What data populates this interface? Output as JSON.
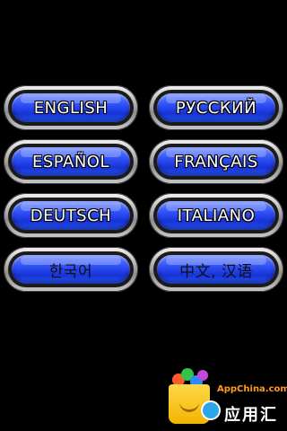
{
  "languages": [
    {
      "label": "ENGLISH"
    },
    {
      "label": "РУССКИЙ"
    },
    {
      "label": "ESPAÑOL"
    },
    {
      "label": "FRANÇAIS"
    },
    {
      "label": "DEUTSCH"
    },
    {
      "label": "ITALIANO"
    },
    {
      "label": "한국어"
    },
    {
      "label": "中文, 汉语"
    }
  ],
  "watermark": {
    "site": "AppChina.com",
    "brand_cn": "应用汇"
  },
  "colors": {
    "background": "#000000",
    "button_blue": "#2f50f6",
    "button_frame": "#b9b9b9",
    "watermark_orange": "#ff9a1a"
  }
}
